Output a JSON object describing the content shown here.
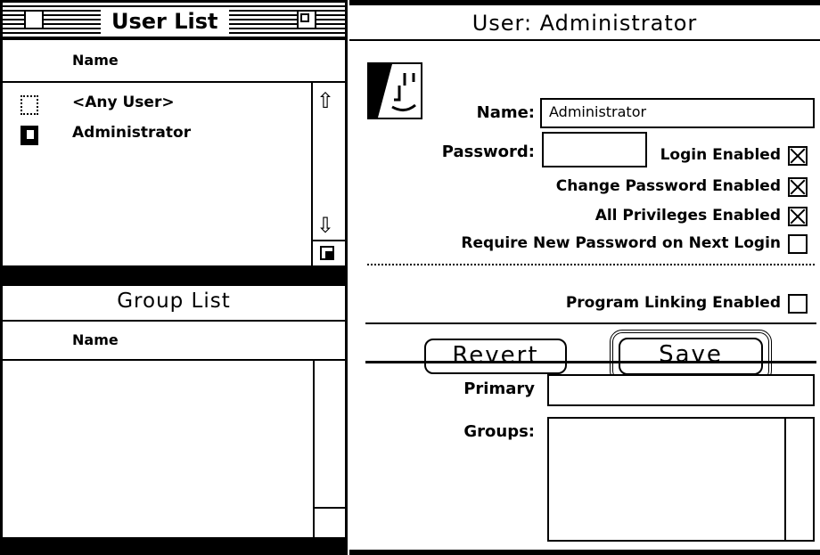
{
  "user_list": {
    "title": "User List",
    "column_header": "Name",
    "items": [
      {
        "label": "<Any User>",
        "icon": "user-outline-icon"
      },
      {
        "label": "Administrator",
        "icon": "user-filled-icon"
      }
    ]
  },
  "group_list": {
    "title": "Group List",
    "column_header": "Name"
  },
  "user_detail": {
    "title": "User: Administrator",
    "name_label": "Name:",
    "name_value": "Administrator",
    "password_label": "Password:",
    "password_value": "",
    "checks": [
      {
        "label": "Login Enabled",
        "checked": true
      },
      {
        "label": "Change Password Enabled",
        "checked": true
      },
      {
        "label": "All Privileges Enabled",
        "checked": true
      },
      {
        "label": "Require New Password on Next Login",
        "checked": false
      },
      {
        "label": "Program Linking Enabled",
        "checked": false
      }
    ],
    "revert_label": "Revert",
    "save_label": "Save",
    "primary_label": "Primary",
    "primary_value": "",
    "groups_label": "Groups:"
  },
  "icons": [
    "user-face-icon",
    "scroll-up-arrow-icon",
    "scroll-down-arrow-icon",
    "grow-box-icon",
    "close-box-icon",
    "zoom-box-icon"
  ]
}
